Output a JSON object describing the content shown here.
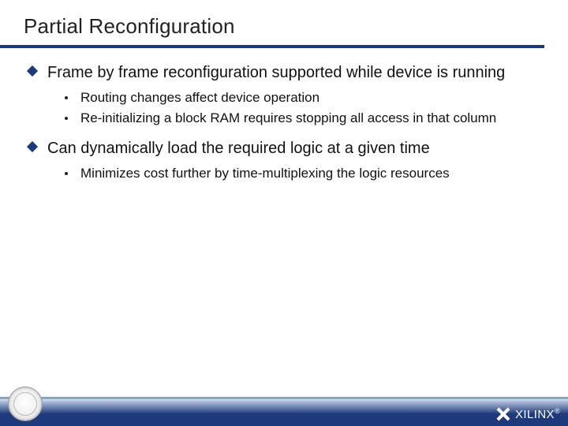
{
  "title": "Partial Reconfiguration",
  "bullets": {
    "b1": "Frame by frame reconfiguration supported while device is running",
    "b1_sub1": "Routing changes affect device operation",
    "b1_sub2": "Re-initializing a block RAM requires stopping all access in that column",
    "b2": "Can dynamically load the required logic at a given time",
    "b2_sub1": "Minimizes cost further by time-multiplexing the logic resources"
  },
  "footer": {
    "brand": "XILINX",
    "reg": "®"
  }
}
